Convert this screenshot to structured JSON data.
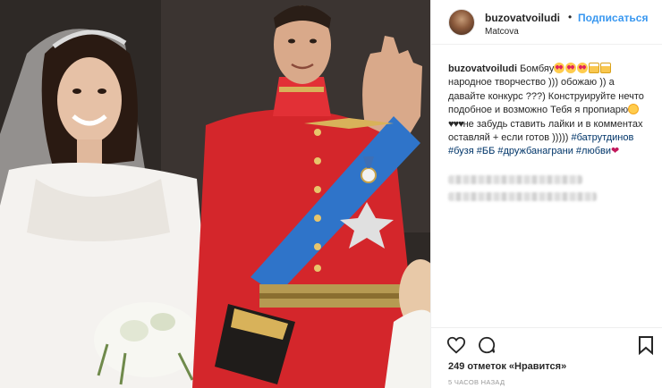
{
  "header": {
    "username": "buzovatvoiludi",
    "separator": "•",
    "follow_label": "Подписаться",
    "location": "Matcova"
  },
  "caption": {
    "username": "buzovatvoiludi",
    "text_1": "Бомбяу",
    "text_2": "народное творчество ))) обожаю )) а давайте конкурс ???) Конструируйте нечто подобное и возможно Тебя я пропиарю",
    "hearts": "♥♥♥",
    "text_3": "не забудь ставить лайки и в комментах оставляй + если готов )))))",
    "hashtags": [
      "#батрутдинов",
      "#бузя",
      "#ББ",
      "#дружбанаграни",
      "#любви"
    ],
    "end_heart": "❤"
  },
  "footer": {
    "likes_count": "249",
    "likes_word": "отметок «Нравится»",
    "timestamp": "5 ЧАСОВ НАЗАД"
  },
  "icons": {
    "like": "heart-outline-icon",
    "comment": "comment-bubble-icon",
    "save": "bookmark-icon"
  }
}
